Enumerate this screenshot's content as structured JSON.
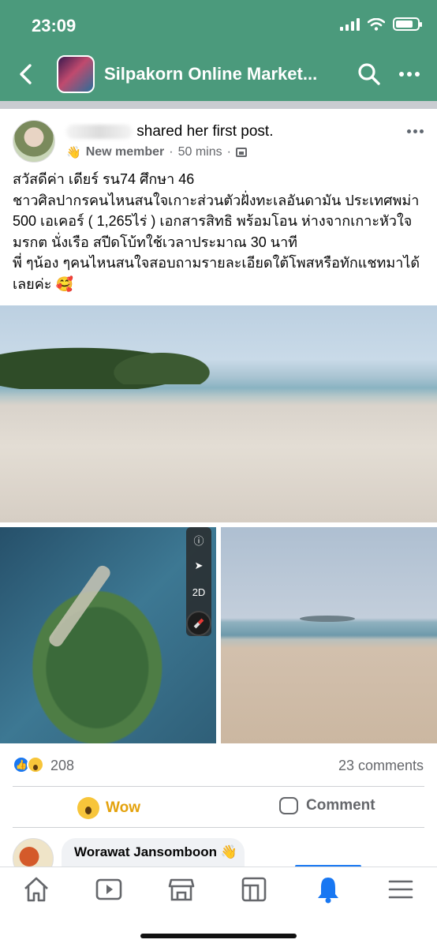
{
  "status_bar": {
    "time": "23:09"
  },
  "header": {
    "group_name": "Silpakorn Online Market..."
  },
  "post": {
    "author_suffix": "shared her first post.",
    "badge": "New member",
    "time": "50 mins",
    "text_lines": [
      "สวัสดีค่า เดียร์ รน74 ศึกษา 46",
      "ชาวศิลปากรคนไหนสนใจเกาะส่วนตัวฝั่งทะเลอันดามัน ประเทศพม่า",
      "500 เอเคอร์ ( 1,265ไร่ ) เอกสารสิทธิ พร้อมโอน ห่างจากเกาะหัวใจ",
      "มรกต นั่งเรือ สปีดโบ้ทใช้เวลาประมาณ 30 นาที",
      "พี่ ๆน้อง ๆคนไหนสนใจสอบถามรายละเอียดใต้โพสหรือทักแชทมาได้",
      "เลยค่ะ 🥰"
    ],
    "map_controls": {
      "info": "ⓘ",
      "locate": "➤",
      "mode": "2D"
    },
    "reaction_count": "208",
    "comment_count": "23 comments",
    "actions": {
      "wow": "Wow",
      "comment": "Comment"
    }
  },
  "comment": {
    "author": "Worawat Jansomboon"
  },
  "colors": {
    "header": "#4b9a7c",
    "wow": "#e4a20d",
    "like": "#1877f2",
    "active_nav": "#1877f2"
  },
  "nav": [
    "home-icon",
    "watch-icon",
    "marketplace-icon",
    "groups-icon",
    "notifications-icon",
    "menu-icon"
  ]
}
